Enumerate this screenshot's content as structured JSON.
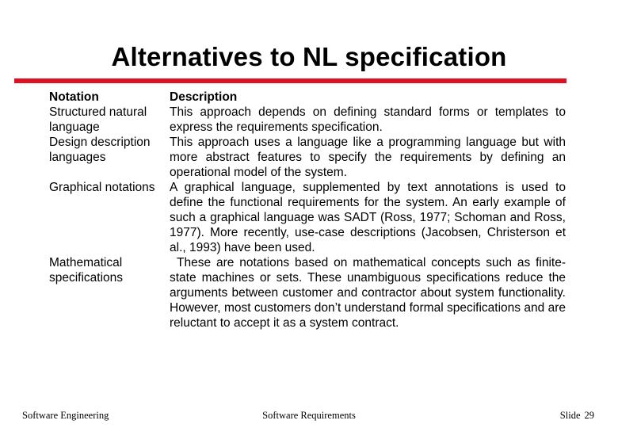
{
  "slide": {
    "title": "Alternatives to NL specification",
    "accent_color": "#dd1122"
  },
  "table": {
    "headers": {
      "notation": "Notation",
      "description": "Description"
    },
    "rows": [
      {
        "notation": "Structured natural language",
        "description": "This approach depends on defining standard forms or templates to express the requirements specification."
      },
      {
        "notation": "Design description languages",
        "description": "This approach uses a language like a programming language but with more abstract features to specify the requirements by defining an operational model of the system."
      },
      {
        "notation": "Graphical notations",
        "description": "A graphical language, supplemented by text annotations is used to define the functional requirements for the system. An early example of such a graphical language was SADT (Ross, 1977; Schoman and Ross, 1977). More recently, use-case descriptions (Jacobsen, Christerson et al., 1993) have been used."
      },
      {
        "notation": "Mathematical specifications",
        "description": "These are notations based on mathematical concepts such as finite-state machines or sets. These unambiguous specifications reduce the arguments between customer and contractor about system functionality. However, most customers don’t understand formal specifications and are reluctant to accept it as a system contract."
      }
    ]
  },
  "footer": {
    "left": "Software Engineering",
    "center": "Software Requirements",
    "slide_label": "Slide",
    "slide_number": "29"
  }
}
